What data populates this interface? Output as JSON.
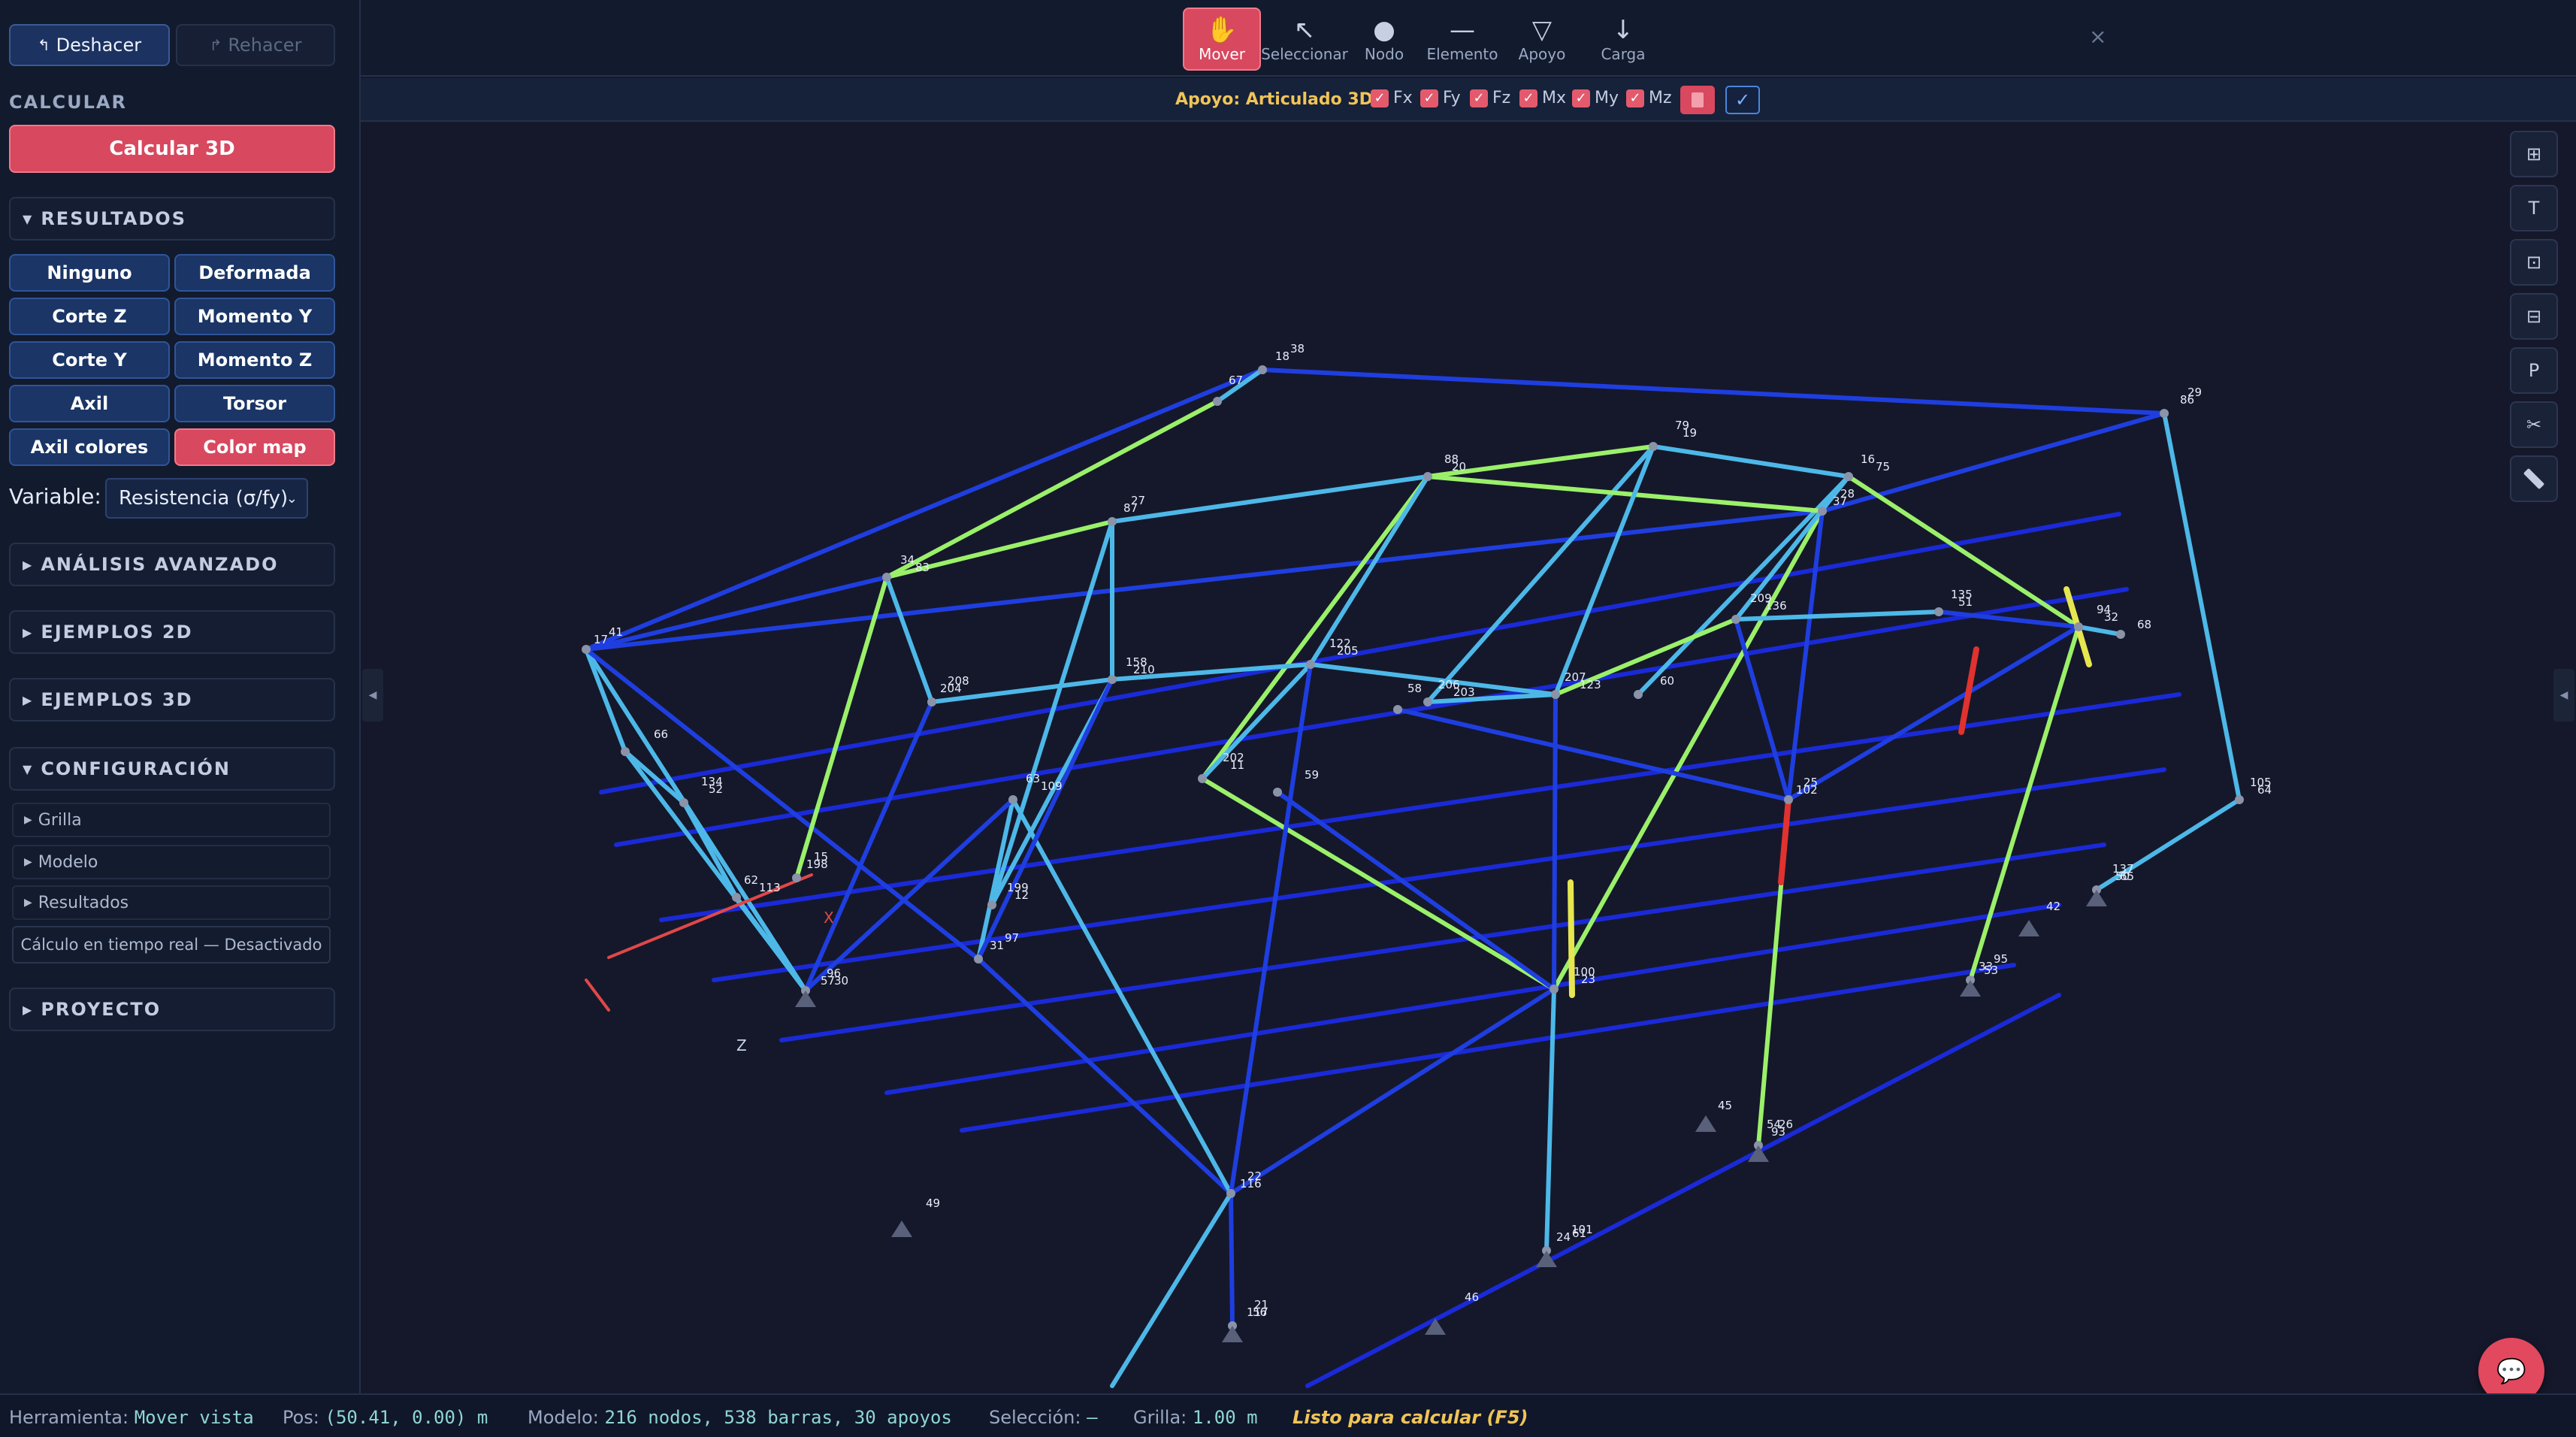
{
  "history": {
    "undo": "Deshacer",
    "redo": "Rehacer"
  },
  "sidebar": {
    "calc_section": "CALCULAR",
    "calc_button": "Calcular 3D",
    "results": {
      "title": "RESULTADOS",
      "buttons": [
        "Ninguno",
        "Deformada",
        "Corte Z",
        "Momento Y",
        "Corte Y",
        "Momento Z",
        "Axil",
        "Torsor",
        "Axil colores",
        "Color map"
      ],
      "active": "Color map"
    },
    "variable": {
      "label": "Variable:",
      "value": "Resistencia (σ/fy)"
    },
    "advanced": "ANÁLISIS AVANZADO",
    "examples_2d": "EJEMPLOS 2D",
    "examples_3d": "EJEMPLOS 3D",
    "config": {
      "title": "CONFIGURACIÓN",
      "items": [
        "Grilla",
        "Modelo",
        "Resultados"
      ],
      "realtime": "Cálculo en tiempo real — Desactivado"
    },
    "project": "PROYECTO"
  },
  "toolbar": {
    "tools": [
      {
        "label": "Mover",
        "icon": "hand-icon",
        "active": true
      },
      {
        "label": "Seleccionar",
        "icon": "cursor-arrow-icon",
        "active": false
      },
      {
        "label": "Nodo",
        "icon": "node-dot-icon",
        "active": false
      },
      {
        "label": "Elemento",
        "icon": "line-element-icon",
        "active": false
      },
      {
        "label": "Apoyo",
        "icon": "support-triangle-icon",
        "active": false
      },
      {
        "label": "Carga",
        "icon": "load-arrow-icon",
        "active": false
      }
    ],
    "close": "×"
  },
  "support_bar": {
    "label": "Apoyo: Articulado 3D",
    "dofs": [
      "Fx",
      "Fy",
      "Fz",
      "Mx",
      "My",
      "Mz"
    ],
    "confirm": "✓"
  },
  "view_tools": [
    {
      "icon": "grid-icon",
      "glyph": "⊞"
    },
    {
      "icon": "top-view-icon",
      "glyph": "T"
    },
    {
      "icon": "front-view-icon",
      "glyph": "⊡"
    },
    {
      "icon": "side-view-icon",
      "glyph": "⊟"
    },
    {
      "icon": "perspective-icon",
      "glyph": "P"
    },
    {
      "icon": "scissors-icon",
      "glyph": "✂"
    },
    {
      "icon": "ruler-icon",
      "glyph": "📏"
    }
  ],
  "viewport": {
    "axis_labels": {
      "x": "X",
      "z": "Z"
    },
    "node_labels": [
      "17",
      "18",
      "28",
      "29",
      "30",
      "31",
      "22",
      "21",
      "23",
      "24",
      "25",
      "26",
      "32",
      "33",
      "34",
      "27",
      "20",
      "19",
      "16",
      "15",
      "12",
      "11",
      "206",
      "208",
      "210",
      "205",
      "207",
      "209",
      "51",
      "52",
      "62",
      "63",
      "64",
      "65",
      "66",
      "67",
      "68",
      "60",
      "59",
      "58",
      "57",
      "56",
      "61",
      "54",
      "53",
      "50",
      "49",
      "46",
      "45",
      "42",
      "41",
      "38",
      "37",
      "86",
      "96",
      "97",
      "116",
      "117",
      "100",
      "101",
      "102",
      "93",
      "94",
      "95",
      "83",
      "87",
      "88",
      "79",
      "75",
      "198",
      "199",
      "202",
      "203",
      "204",
      "158",
      "122",
      "123",
      "136",
      "135",
      "134",
      "113",
      "109",
      "105",
      "137"
    ]
  },
  "status": {
    "tool_label": "Herramienta:",
    "tool_value": "Mover vista",
    "pos_label": "Pos:",
    "pos_value": "(50.41, 0.00) m",
    "model_label": "Modelo:",
    "model_value": "216 nodos, 538 barras, 30 apoyos",
    "selection_label": "Selección:",
    "selection_value": "—",
    "grid_label": "Grilla:",
    "grid_value": "1.00 m",
    "ready": "Listo para calcular (F5)"
  },
  "colors": {
    "accent": "#d8485f",
    "primary": "#1a3566",
    "warning": "#f0c457",
    "member_low": "#1f3ee0",
    "member_mid": "#4db8e8",
    "member_high": "#9bf06a",
    "member_critical": "#e0322f"
  }
}
